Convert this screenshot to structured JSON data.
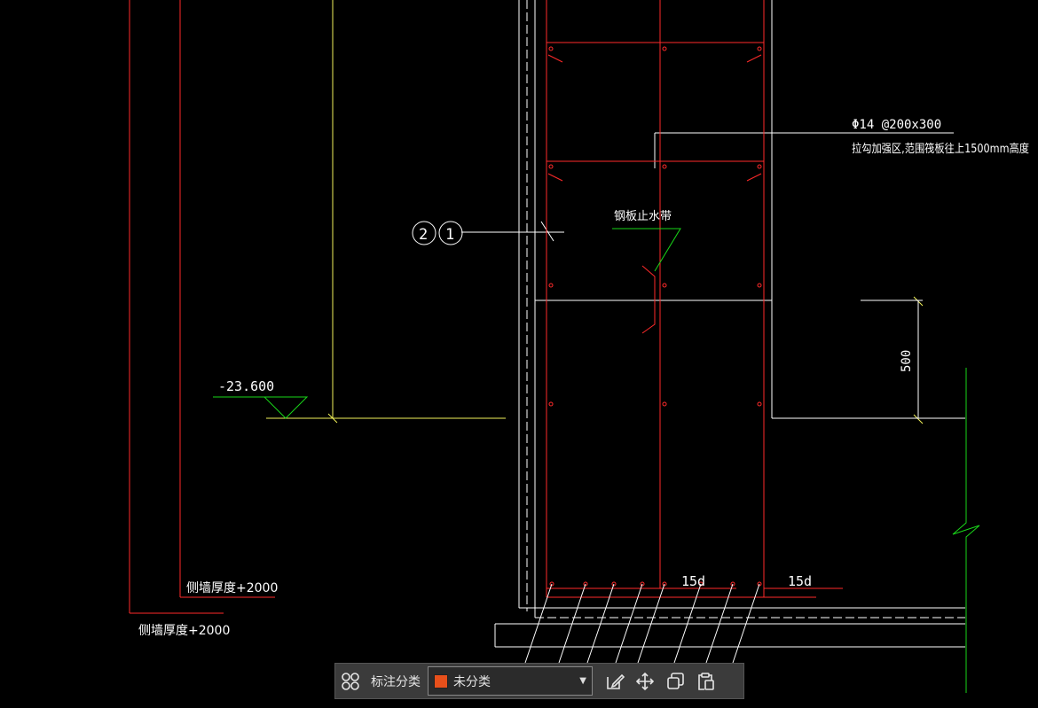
{
  "drawing": {
    "elevation_label": "-23.600",
    "rebar_label_line1": "Φ14 @200x300",
    "rebar_label_line2": "拉勾加强区,范围筏板往上1500mm高度",
    "waterstop_label": "钢板止水带",
    "dimension_500": "500",
    "anchor_label_left": "15d",
    "anchor_label_right": "15d",
    "wall_thickness_label_1": "侧墙厚度+2000",
    "wall_thickness_label_2": "侧墙厚度+2000",
    "callout_2": "2",
    "callout_1": "1"
  },
  "toolbar": {
    "category_label": "标注分类",
    "selected_category": "未分类",
    "selected_color": "#e8501b",
    "icons": [
      "grid-icon",
      "edit-icon",
      "move-icon",
      "copy-icon",
      "paste-icon"
    ]
  },
  "colors": {
    "background": "#000000",
    "red": "#ff2a2a",
    "white": "#ffffff",
    "yellow": "#f2f25a",
    "green": "#19d619"
  }
}
